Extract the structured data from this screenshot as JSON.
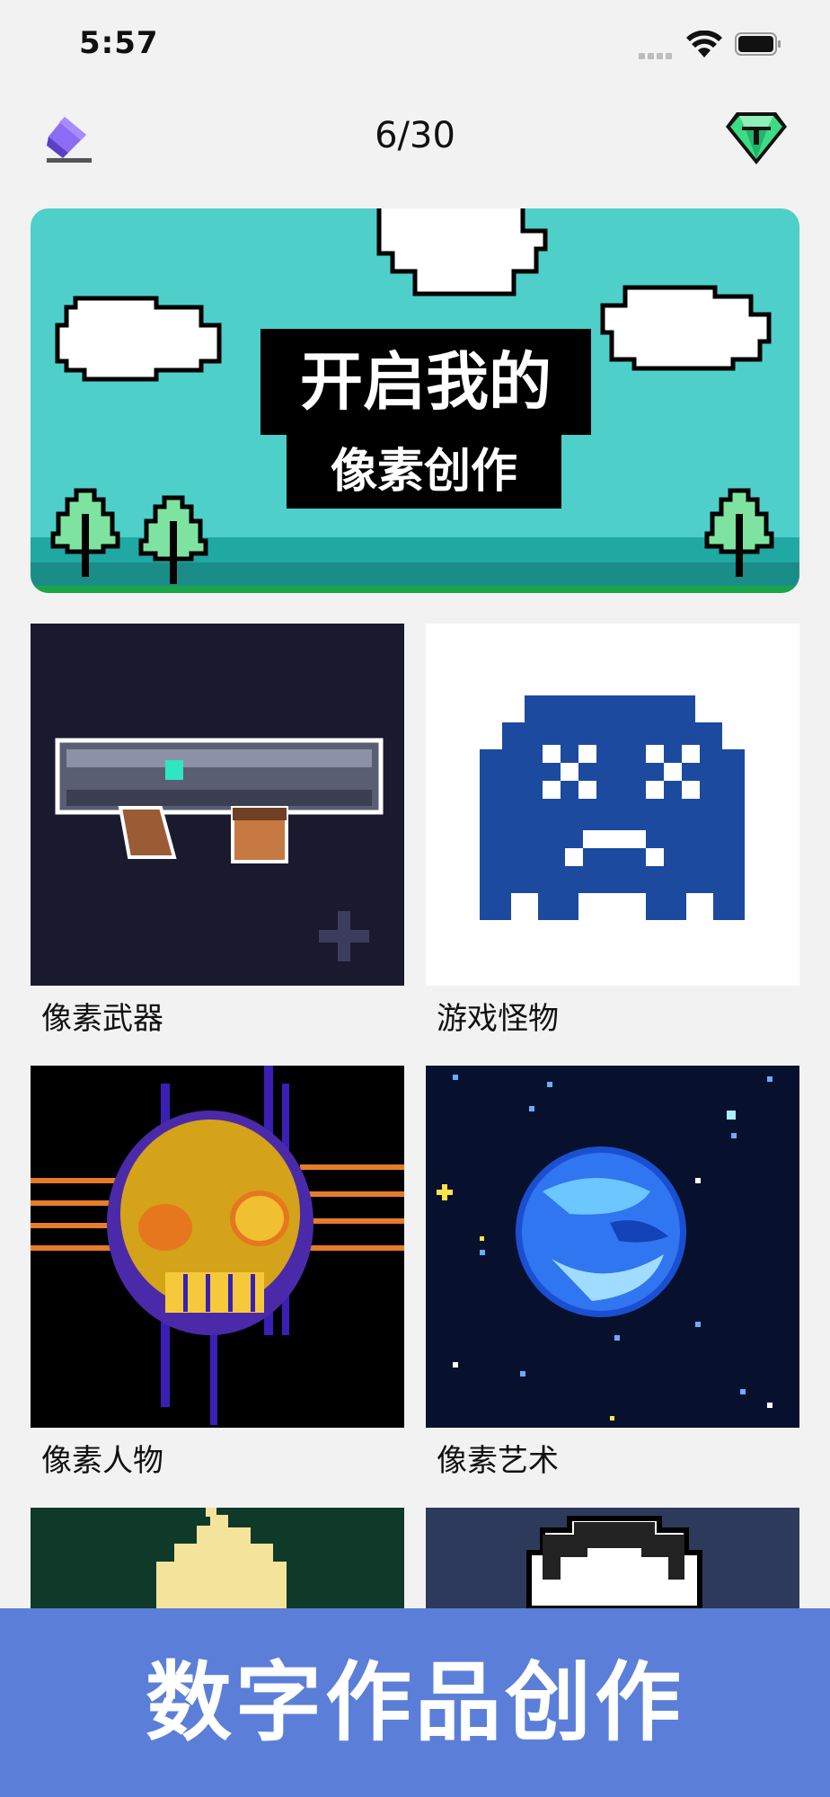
{
  "status_bar": {
    "time": "5:57"
  },
  "header": {
    "progress": "6/30",
    "left_icon": "eraser-icon",
    "right_icon": "diamond-icon"
  },
  "banner": {
    "title": "开启我的",
    "subtitle": "像素创作"
  },
  "categories": [
    {
      "label": "像素武器"
    },
    {
      "label": "游戏怪物"
    },
    {
      "label": "像素人物"
    },
    {
      "label": "像素艺术"
    }
  ],
  "promo": {
    "text": "数字作品创作"
  },
  "colors": {
    "background": "#f2f2f2",
    "banner_sky": "#4ecfca",
    "promo": "#5b7fd8"
  }
}
